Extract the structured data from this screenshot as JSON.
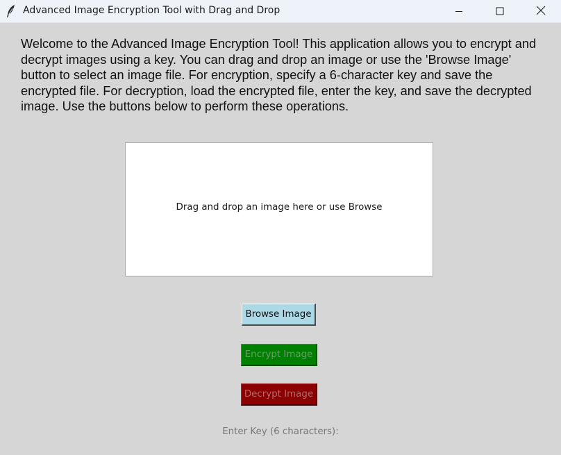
{
  "window": {
    "title": "Advanced Image Encryption Tool with Drag and Drop",
    "icon": "feather-icon",
    "controls": [
      "minimize-icon",
      "maximize-icon",
      "close-icon"
    ]
  },
  "intro": {
    "text": "Welcome to the Advanced Image Encryption Tool! This application allows you to encrypt and decrypt images using a key. You can drag and drop an image or use the 'Browse Image' button to select an image file. For encryption, specify a 6-character key and save the encrypted file. For decryption, load the encrypted file, enter the key, and save the decrypted image. Use the buttons below to perform these operations."
  },
  "dropzone": {
    "text": "Drag and drop an image here or use Browse"
  },
  "buttons": {
    "browse": "Browse Image",
    "encrypt": "Encrypt Image",
    "decrypt": "Decrypt Image"
  },
  "key": {
    "label": "Enter Key (6 characters):"
  },
  "colors": {
    "background": "#d6d6d6",
    "browse_button": "#add8e6",
    "encrypt_button": "#008000",
    "decrypt_button": "#8b0000",
    "dropzone": "#ffffff"
  }
}
